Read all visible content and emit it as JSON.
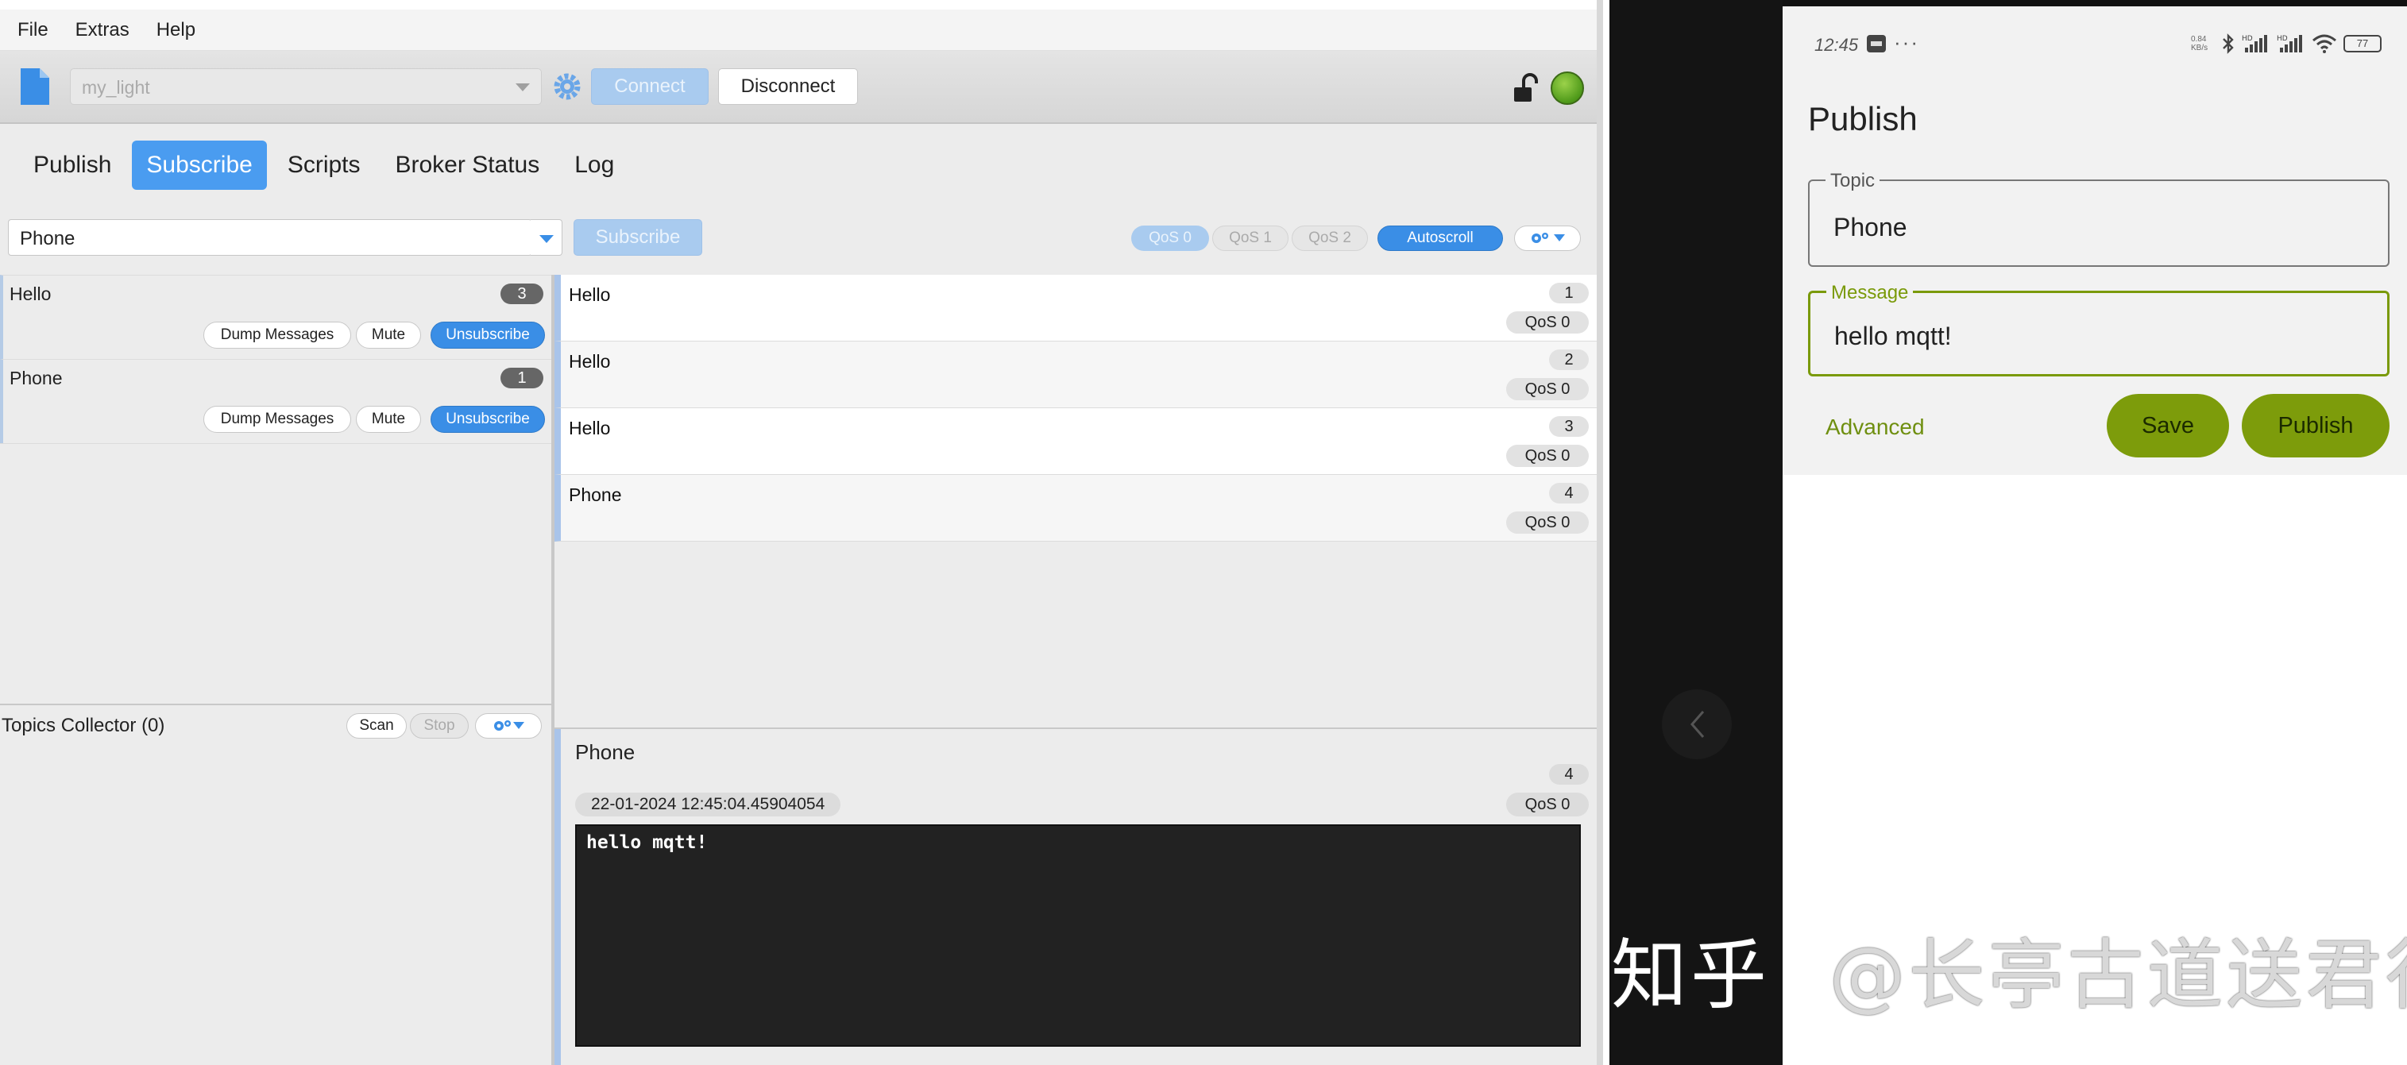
{
  "menu": [
    "File",
    "Extras",
    "Help"
  ],
  "toolbar": {
    "profile": "my_light",
    "connect_label": "Connect",
    "disconnect_label": "Disconnect"
  },
  "tabs": [
    "Publish",
    "Subscribe",
    "Scripts",
    "Broker Status",
    "Log"
  ],
  "subscribe": {
    "topic_value": "Phone",
    "button_label": "Subscribe",
    "qos_options": [
      "QoS 0",
      "QoS 1",
      "QoS 2"
    ],
    "autoscroll_label": "Autoscroll"
  },
  "subscriptions": [
    {
      "name": "Hello",
      "count": "3",
      "dump_label": "Dump Messages",
      "mute_label": "Mute",
      "unsubscribe_label": "Unsubscribe"
    },
    {
      "name": "Phone",
      "count": "1",
      "dump_label": "Dump Messages",
      "mute_label": "Mute",
      "unsubscribe_label": "Unsubscribe"
    }
  ],
  "topics_collector": {
    "title": "Topics Collector (0)",
    "scan_label": "Scan",
    "stop_label": "Stop"
  },
  "messages": [
    {
      "topic": "Hello",
      "num": "1",
      "qos": "QoS 0"
    },
    {
      "topic": "Hello",
      "num": "2",
      "qos": "QoS 0"
    },
    {
      "topic": "Hello",
      "num": "3",
      "qos": "QoS 0"
    },
    {
      "topic": "Phone",
      "num": "4",
      "qos": "QoS 0"
    }
  ],
  "detail": {
    "topic": "Phone",
    "num": "4",
    "timestamp": "22-01-2024  12:45:04.45904054",
    "qos": "QoS 0",
    "payload": "hello mqtt!"
  },
  "phone": {
    "time": "12:45",
    "dots": "···",
    "speed": "0.84 KB/s",
    "battery": "77",
    "title": "Publish",
    "topic_label": "Topic",
    "topic_value": "Phone",
    "message_label": "Message",
    "message_value": "hello mqtt!",
    "advanced_label": "Advanced",
    "save_label": "Save",
    "publish_label": "Publish",
    "accent": "#7d9c0b"
  },
  "watermark": {
    "site": "知乎",
    "handle": "@长亭古道送君行"
  },
  "colors": {
    "accent_blue": "#4a9cf0",
    "button_blue": "#3a8ee6",
    "status_led": "#4f9a1a"
  }
}
